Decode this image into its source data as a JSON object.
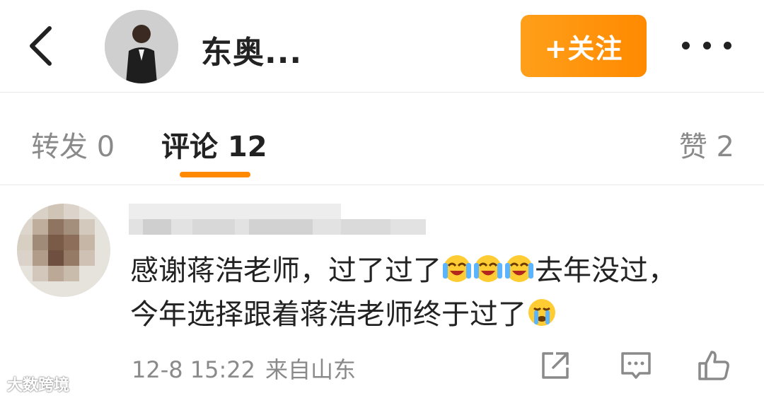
{
  "header": {
    "username": "东奥...",
    "follow_label": "+关注"
  },
  "tabs": {
    "repost": "转发 0",
    "comment": "评论 12",
    "like": "赞 2"
  },
  "comment": {
    "line1_a": "感谢蒋浩老师，过了过了",
    "line1_b": "去年没过，",
    "line2": "今年选择跟着蒋浩老师终于过了",
    "timestamp": "12-8 15:22",
    "location": "来自山东"
  },
  "watermark": "大数跨境",
  "colors": {
    "accent": "#ff8a00",
    "muted_text": "#8a8a8a",
    "primary_text": "#222222"
  },
  "icons": [
    "back-icon",
    "more-icon",
    "share-icon",
    "comment-icon",
    "like-icon",
    "laugh-cry-emoji",
    "crying-emoji"
  ]
}
